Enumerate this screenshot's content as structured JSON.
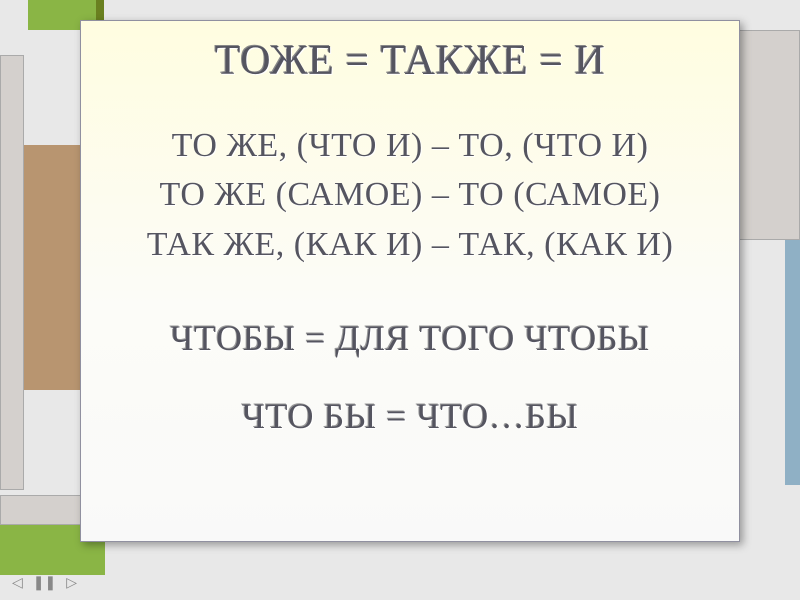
{
  "title": "ТОЖЕ = ТАКЖЕ = И",
  "lines": {
    "l1": "ТО  ЖЕ, (ЧТО И) – ТО, (ЧТО И)",
    "l2": "ТО  ЖЕ (САМОЕ) – ТО (САМОЕ)",
    "l3": "ТАК  ЖЕ, (КАК И) – ТАК, (КАК И)"
  },
  "sub1": "ЧТОБЫ = ДЛЯ ТОГО ЧТОБЫ",
  "sub2": "ЧТО  БЫ = ЧТО…БЫ",
  "nav": {
    "prev": "◁",
    "pause": "❚❚",
    "next": "▷"
  }
}
